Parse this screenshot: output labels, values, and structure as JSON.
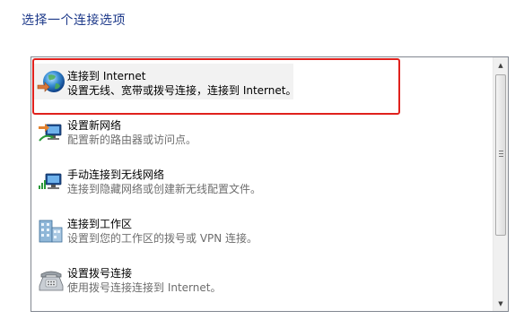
{
  "page": {
    "title": "选择一个连接选项"
  },
  "options": [
    {
      "title": "连接到 Internet",
      "description": "设置无线、宽带或拨号连接，连接到 Internet。",
      "icon": "globe-icon",
      "selected": true
    },
    {
      "title": "设置新网络",
      "description": "配置新的路由器或访问点。",
      "icon": "network-setup-icon",
      "selected": false
    },
    {
      "title": "手动连接到无线网络",
      "description": "连接到隐藏网络或创建新无线配置文件。",
      "icon": "wireless-network-icon",
      "selected": false
    },
    {
      "title": "连接到工作区",
      "description": "设置到您的工作区的拨号或 VPN 连接。",
      "icon": "workplace-icon",
      "selected": false
    },
    {
      "title": "设置拨号连接",
      "description": "使用拨号连接连接到 Internet。",
      "icon": "telephone-icon",
      "selected": false
    }
  ],
  "colors": {
    "title": "#1e3a8a",
    "highlight_frame": "#e0211d",
    "selected_background": "#f2f2f2"
  }
}
